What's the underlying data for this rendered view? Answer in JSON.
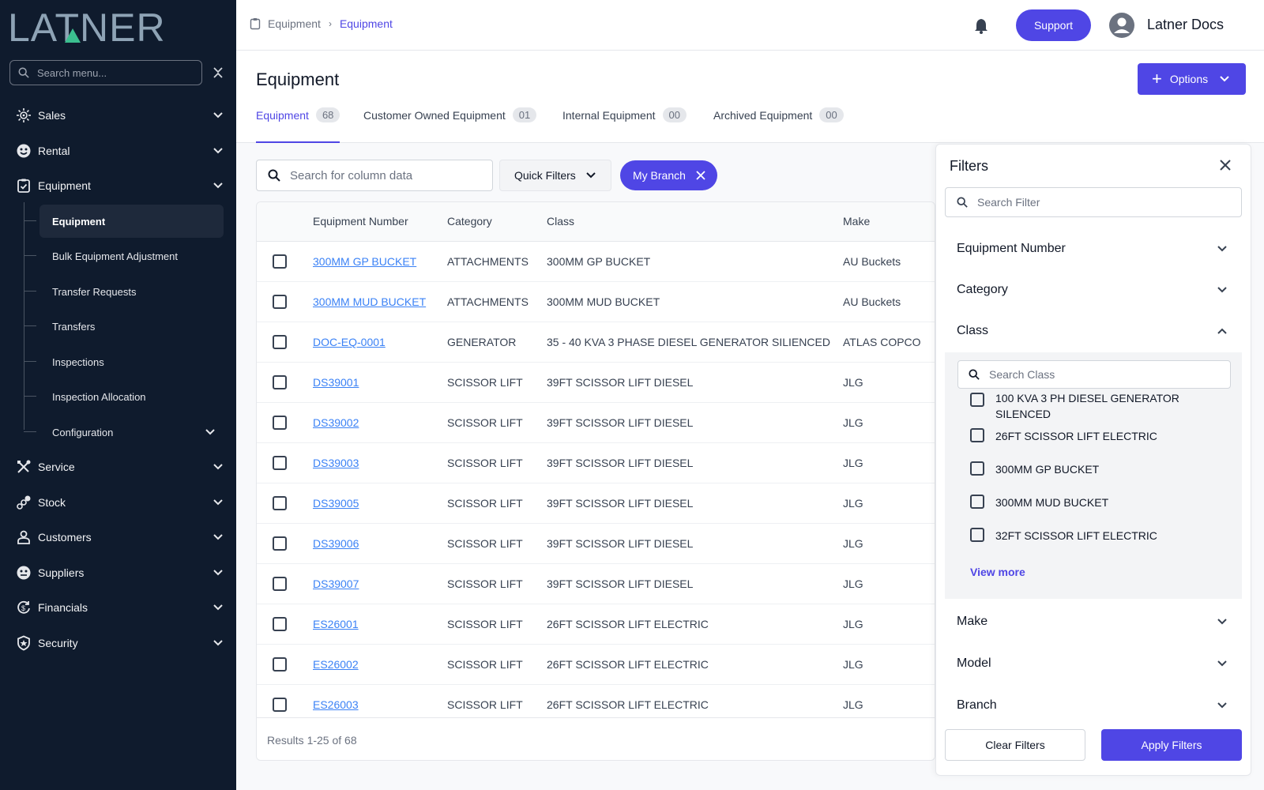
{
  "colors": {
    "sidebar_bg": "#0f1b2d",
    "accent": "#4f46e5",
    "link": "#3b82f6"
  },
  "logo": {
    "text": "LATNER"
  },
  "sidebar": {
    "search_placeholder": "Search menu...",
    "items": [
      {
        "label": "Sales",
        "icon": "gear-sun-icon"
      },
      {
        "label": "Rental",
        "icon": "smiley-icon"
      },
      {
        "label": "Equipment",
        "icon": "clipboard-icon"
      },
      {
        "label": "Service",
        "icon": "tools-icon"
      },
      {
        "label": "Stock",
        "icon": "stock-icon"
      },
      {
        "label": "Customers",
        "icon": "user-icon"
      },
      {
        "label": "Suppliers",
        "icon": "supplier-icon"
      },
      {
        "label": "Financials",
        "icon": "currency-cycle-icon"
      },
      {
        "label": "Security",
        "icon": "shield-icon"
      }
    ],
    "sub_items": [
      {
        "label": "Equipment"
      },
      {
        "label": "Bulk Equipment Adjustment"
      },
      {
        "label": "Transfer Requests"
      },
      {
        "label": "Transfers"
      },
      {
        "label": "Inspections"
      },
      {
        "label": "Inspection Allocation"
      },
      {
        "label": "Configuration"
      }
    ]
  },
  "topbar": {
    "breadcrumb": [
      "Equipment",
      "Equipment"
    ],
    "support_label": "Support",
    "user_name": "Latner Docs"
  },
  "page": {
    "title": "Equipment",
    "options_label": "Options",
    "tabs": [
      {
        "label": "Equipment",
        "count": "68"
      },
      {
        "label": "Customer Owned Equipment",
        "count": "01"
      },
      {
        "label": "Internal Equipment",
        "count": "00"
      },
      {
        "label": "Archived Equipment",
        "count": "00"
      }
    ]
  },
  "toolbar": {
    "search_placeholder": "Search for column data",
    "quick_filters_label": "Quick Filters",
    "chip_label": "My Branch"
  },
  "table": {
    "columns": [
      "Equipment Number",
      "Category",
      "Class",
      "Make"
    ],
    "rows": [
      [
        "300MM GP BUCKET",
        "ATTACHMENTS",
        "300MM GP BUCKET",
        "AU Buckets"
      ],
      [
        "300MM MUD BUCKET",
        "ATTACHMENTS",
        "300MM MUD BUCKET",
        "AU Buckets"
      ],
      [
        "DOC-EQ-0001",
        "GENERATOR",
        "35 - 40 KVA 3 PHASE DIESEL GENERATOR SILIENCED",
        "ATLAS COPCO"
      ],
      [
        "DS39001",
        "SCISSOR LIFT",
        "39FT SCISSOR LIFT DIESEL",
        "JLG"
      ],
      [
        "DS39002",
        "SCISSOR LIFT",
        "39FT SCISSOR LIFT DIESEL",
        "JLG"
      ],
      [
        "DS39003",
        "SCISSOR LIFT",
        "39FT SCISSOR LIFT DIESEL",
        "JLG"
      ],
      [
        "DS39005",
        "SCISSOR LIFT",
        "39FT SCISSOR LIFT DIESEL",
        "JLG"
      ],
      [
        "DS39006",
        "SCISSOR LIFT",
        "39FT SCISSOR LIFT DIESEL",
        "JLG"
      ],
      [
        "DS39007",
        "SCISSOR LIFT",
        "39FT SCISSOR LIFT DIESEL",
        "JLG"
      ],
      [
        "ES26001",
        "SCISSOR LIFT",
        "26FT SCISSOR LIFT ELECTRIC",
        "JLG"
      ],
      [
        "ES26002",
        "SCISSOR LIFT",
        "26FT SCISSOR LIFT ELECTRIC",
        "JLG"
      ],
      [
        "ES26003",
        "SCISSOR LIFT",
        "26FT SCISSOR LIFT ELECTRIC",
        "JLG"
      ]
    ],
    "results_text": "Results 1-25 of 68"
  },
  "filters": {
    "title": "Filters",
    "search_placeholder": "Search Filter",
    "sections": [
      "Equipment Number",
      "Category",
      "Class",
      "Make",
      "Model",
      "Branch"
    ],
    "class_search_placeholder": "Search Class",
    "class_options": [
      "100 KVA 3 PH DIESEL GENERATOR SILENCED",
      "26FT SCISSOR LIFT ELECTRIC",
      "300MM GP BUCKET",
      "300MM MUD BUCKET",
      "32FT SCISSOR LIFT ELECTRIC"
    ],
    "view_more_label": "View more",
    "clear_label": "Clear Filters",
    "apply_label": "Apply Filters"
  }
}
